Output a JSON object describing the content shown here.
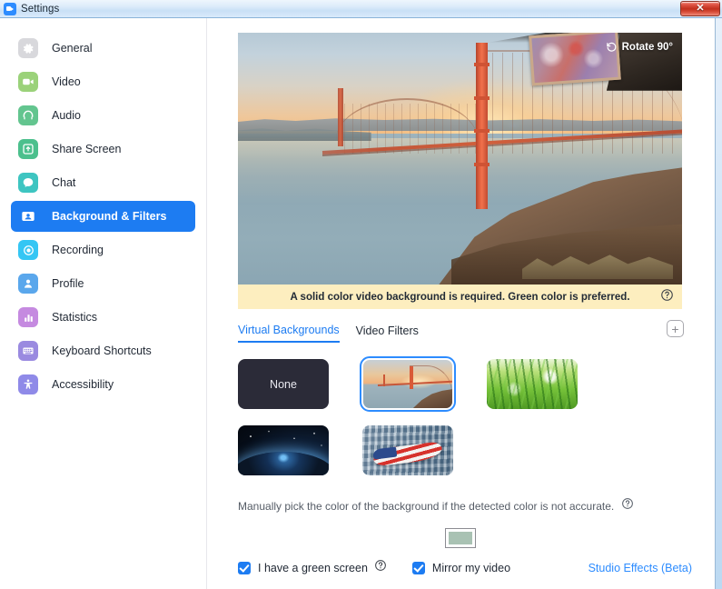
{
  "window": {
    "title": "Settings",
    "app_icon": "zoom-logo-icon",
    "close_label": "✕"
  },
  "sidebar": {
    "items": [
      {
        "label": "General",
        "icon": "gear-icon",
        "color": "#d8d8dc",
        "active": false
      },
      {
        "label": "Video",
        "icon": "camera-icon",
        "color": "#9bd27a",
        "active": false
      },
      {
        "label": "Audio",
        "icon": "headphones-icon",
        "color": "#63c58f",
        "active": false
      },
      {
        "label": "Share Screen",
        "icon": "upload-icon",
        "color": "#4cc08d",
        "active": false
      },
      {
        "label": "Chat",
        "icon": "chat-bubble-icon",
        "color": "#3ec5c1",
        "active": false
      },
      {
        "label": "Background & Filters",
        "icon": "person-card-icon",
        "color": "#ffffff",
        "active": true
      },
      {
        "label": "Recording",
        "icon": "record-icon",
        "color": "#35c6f4",
        "active": false
      },
      {
        "label": "Profile",
        "icon": "user-icon",
        "color": "#5aa7ec",
        "active": false
      },
      {
        "label": "Statistics",
        "icon": "bar-chart-icon",
        "color": "#c58ae0",
        "active": false
      },
      {
        "label": "Keyboard Shortcuts",
        "icon": "keyboard-icon",
        "color": "#9a8ae0",
        "active": false
      },
      {
        "label": "Accessibility",
        "icon": "accessibility-icon",
        "color": "#8f8ae8",
        "active": false
      }
    ],
    "active_color": "#1d7cf2"
  },
  "preview": {
    "rotate_label": "Rotate 90°",
    "rotate_icon": "rotate-ccw-icon",
    "scene": "golden-gate-bridge-sunset"
  },
  "notice": {
    "text": "A solid color video background is required. Green color is preferred.",
    "help_icon": "question-circle-icon",
    "background": "#fdeebf"
  },
  "tabs": {
    "items": [
      {
        "label": "Virtual Backgrounds",
        "active": true
      },
      {
        "label": "Video Filters",
        "active": false
      }
    ],
    "add_icon": "plus-square-icon",
    "add_label": "+",
    "accent": "#1d7cf2"
  },
  "backgrounds": {
    "items": [
      {
        "label": "None",
        "kind": "none",
        "selected": false
      },
      {
        "label": "",
        "kind": "bridge",
        "selected": true
      },
      {
        "label": "",
        "kind": "grass",
        "selected": false
      },
      {
        "label": "",
        "kind": "space",
        "selected": false
      },
      {
        "label": "",
        "kind": "flag",
        "selected": false
      }
    ]
  },
  "manual_pick": {
    "text": "Manually pick the color of the background if the detected color is not accurate.",
    "help_icon": "question-circle-icon",
    "swatch_color": "#a9c2b3"
  },
  "bottom": {
    "green_screen": {
      "label": "I have a green screen",
      "checked": true,
      "help_icon": "question-circle-icon"
    },
    "mirror": {
      "label": "Mirror my video",
      "checked": true
    },
    "studio_effects": {
      "label": "Studio Effects (Beta)",
      "color": "#2d8cff"
    }
  }
}
